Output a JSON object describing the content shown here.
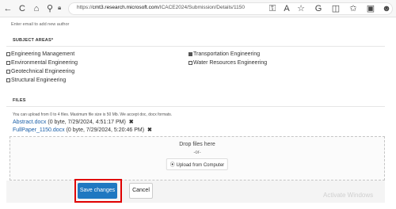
{
  "browser": {
    "url_prefix": "https://",
    "url_host": "cmt3.research.microsoft.com",
    "url_path": "/ICACE2024/Submission/Details/1150",
    "icons": [
      "back-icon",
      "refresh-icon",
      "home-icon",
      "search-icon",
      "lock-icon",
      "key-icon",
      "read-aloud-icon",
      "favorite-icon",
      "extensions-icon",
      "split-screen-icon",
      "favorites-bar-icon",
      "collections-icon",
      "profile-icon"
    ]
  },
  "author_hint": "Enter email to add new author",
  "subjects": {
    "heading": "SUBJECT AREAS*",
    "items": [
      {
        "label": "Engineering Management",
        "checked": false
      },
      {
        "label": "Transportation Engineering",
        "checked": true
      },
      {
        "label": "Environmental Engineering",
        "checked": false
      },
      {
        "label": "Water Resources Engineering",
        "checked": false
      },
      {
        "label": "Geotechnical Engineering",
        "checked": false
      },
      {
        "label": "Structural Engineering",
        "checked": false
      }
    ]
  },
  "files": {
    "heading": "FILES",
    "hint": "You can upload from 0 to 4 files. Maximum file size is 50 Mb. We accept doc, docx formats.",
    "list": [
      {
        "name": "Abstract.docx",
        "meta": "(0 byte, 7/29/2024, 4:51:17 PM)"
      },
      {
        "name": "FullPaper_1150.docx",
        "meta": "(0 byte, 7/29/2024, 5:20:46 PM)"
      }
    ],
    "remove_glyph": "✖",
    "dropzone": {
      "title": "Drop files here",
      "or": "-or-",
      "button": "Upload from Computer"
    }
  },
  "actions": {
    "save": "Save changes",
    "cancel": "Cancel"
  },
  "watermark": "Activate Windows"
}
